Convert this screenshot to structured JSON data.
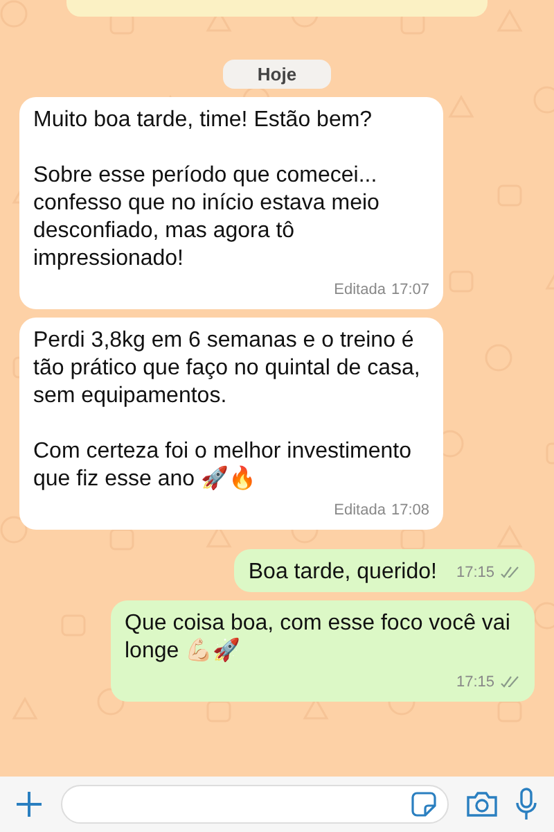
{
  "date_chip": "Hoje",
  "messages": [
    {
      "kind": "incoming",
      "paragraphs": [
        "Muito boa tarde, time! Estão bem?",
        "Sobre esse período que comecei... confesso que no início estava meio desconfiado, mas agora tô impressionado!"
      ],
      "edited_label": "Editada",
      "time": "17:07"
    },
    {
      "kind": "incoming",
      "paragraphs": [
        "Perdi 3,8kg em 6 semanas e o treino é tão prático que faço no quintal de casa, sem equipamentos.",
        "Com certeza foi o melhor investimento que fiz esse ano 🚀🔥"
      ],
      "edited_label": "Editada",
      "time": "17:08"
    },
    {
      "kind": "outgoing",
      "paragraphs": [
        "Boa tarde, querido!"
      ],
      "time": "17:15",
      "read": false
    },
    {
      "kind": "outgoing",
      "paragraphs": [
        "Que coisa boa, com esse foco você vai longe 💪🏻🚀"
      ],
      "time": "17:15",
      "read": false
    }
  ]
}
